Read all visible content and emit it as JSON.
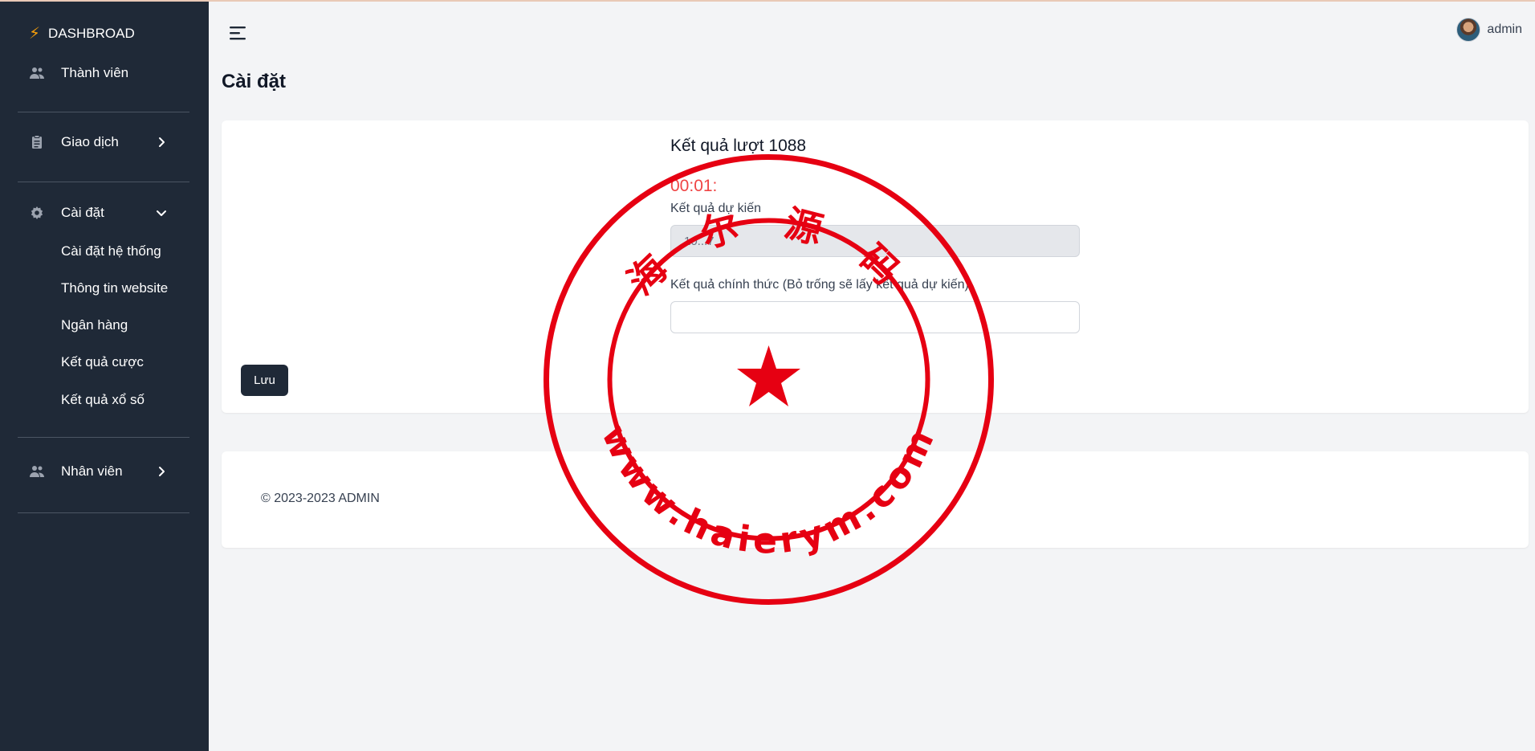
{
  "sidebar": {
    "brand": "DASHBROAD",
    "items": [
      {
        "label": "Thành viên",
        "icon": "users-icon"
      },
      {
        "label": "Giao dịch",
        "icon": "clipboard-icon"
      },
      {
        "label": "Cài đặt",
        "icon": "gear-icon"
      },
      {
        "label": "Nhân viên",
        "icon": "users-icon"
      }
    ],
    "settings_sub": [
      "Cài đặt hệ thống",
      "Thông tin website",
      "Ngân hàng",
      "Kết quả cược",
      "Kết quả xổ số"
    ]
  },
  "header": {
    "user": "admin"
  },
  "page": {
    "title": "Cài đặt"
  },
  "form": {
    "round_title": "Kết quả lượt 1088",
    "countdown": "00:01:",
    "expected_label": "Kết quả dự kiến",
    "expected_value": "10...7",
    "official_label": "Kết quả chính thức (Bỏ trống sẽ lấy kết quả dự kiến)",
    "official_value": "",
    "save_label": "Lưu"
  },
  "footer": {
    "copyright": "© 2023-2023 ADMIN"
  },
  "watermark": {
    "top_text": "海 尔 源 码",
    "bottom_text": "www.haierym.com",
    "color": "#e60012"
  },
  "colors": {
    "sidebar_bg": "#1f2937",
    "accent_bolt": "#f59e0b",
    "countdown": "#ef4444"
  }
}
